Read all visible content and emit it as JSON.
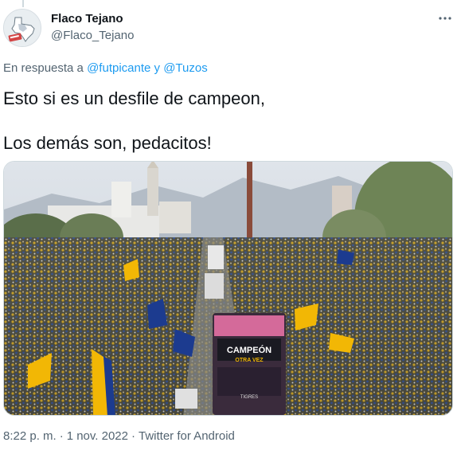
{
  "author": {
    "name": "Flaco Tejano",
    "handle": "@Flaco_Tejano"
  },
  "reply": {
    "prefix": "En respuesta a",
    "mention_1": "@futpicante",
    "conjunction": "y",
    "mention_2": "@Tuzos"
  },
  "tweet": {
    "line_1": "Esto si es un desfile de campeon,",
    "line_2": "Los demás son, pedacitos!"
  },
  "media": {
    "bus_banner_line_1": "CAMPEÓN",
    "bus_banner_line_2": "OTRA VEZ",
    "bus_plate": "TIGRES"
  },
  "meta": {
    "time": "8:22 p. m.",
    "separator": "·",
    "date": "1 nov. 2022",
    "source": "Twitter for Android"
  },
  "icons": {
    "more": "more-horizontal-icon",
    "avatar_shape": "texas-shape"
  },
  "colors": {
    "link": "#1d9bf0",
    "secondary_text": "#536471",
    "primary_text": "#0f1419",
    "tigres_yellow": "#f2b705",
    "tigres_blue": "#1c3b8f"
  }
}
